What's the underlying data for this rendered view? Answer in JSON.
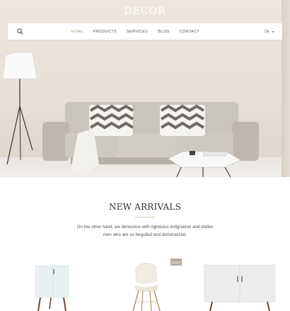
{
  "header": {
    "logo": "DECOR"
  },
  "nav": {
    "items": [
      {
        "label": "HOME",
        "active": true
      },
      {
        "label": "PRODUCTS",
        "active": false
      },
      {
        "label": "SERVICES",
        "active": false
      },
      {
        "label": "BLOG",
        "active": false
      },
      {
        "label": "CONTACT",
        "active": false
      }
    ],
    "language": "DE"
  },
  "section": {
    "title": "NEW ARRIVALS",
    "description": "On the other hand, we denounce with righteous indignation and dislike men who are so beguiled and demoralized."
  },
  "products": [
    {
      "name": "white nightstand",
      "badge": ""
    },
    {
      "name": "eames chair",
      "badge": "SALE!"
    },
    {
      "name": "sideboard",
      "badge": ""
    }
  ],
  "colors": {
    "accent": "#9aa878",
    "badge": "#b8ab99"
  }
}
